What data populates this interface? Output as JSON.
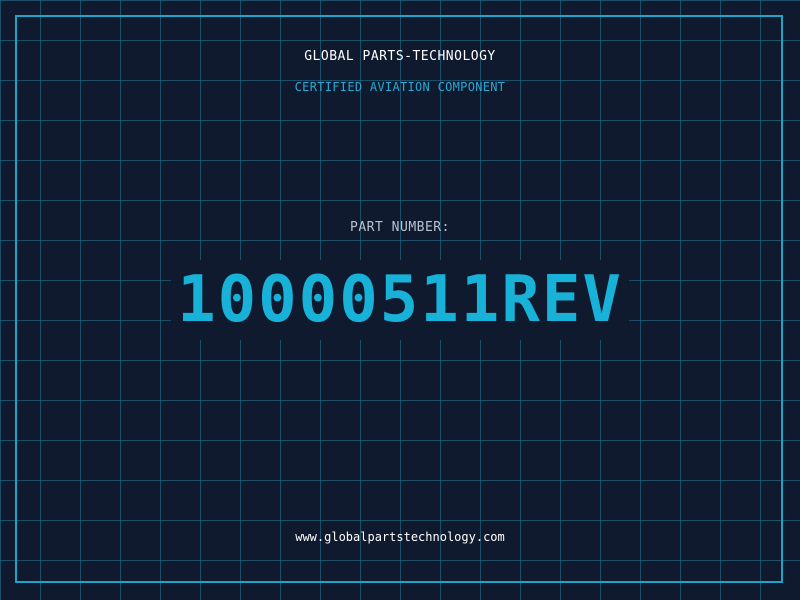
{
  "header": {
    "company": "GLOBAL PARTS-TECHNOLOGY",
    "subtitle": "CERTIFIED AVIATION COMPONENT"
  },
  "part": {
    "label": "PART NUMBER:",
    "number": "10000511REV"
  },
  "footer": {
    "website": "www.globalpartstechnology.com"
  },
  "colors": {
    "background": "#0f1a2e",
    "grid": "#28789a",
    "accent": "#18b2d9",
    "frame": "#1fa3c9",
    "text_primary": "#ffffff",
    "text_muted": "#b9c3d0"
  }
}
